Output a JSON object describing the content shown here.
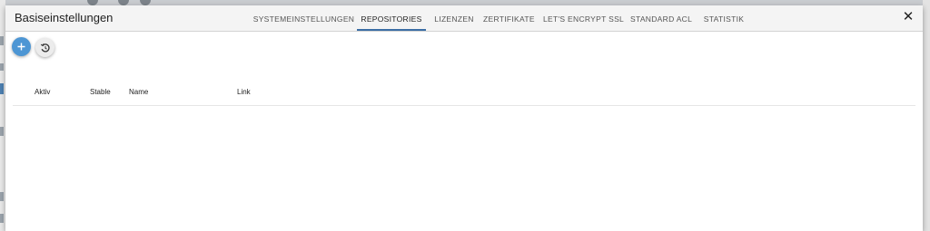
{
  "dialog": {
    "title": "Basiseinstellungen",
    "close_icon": "close-icon"
  },
  "tabs": [
    {
      "label": "SYSTEMEINSTELLUNGEN",
      "active": false
    },
    {
      "label": "REPOSITORIES",
      "active": true
    },
    {
      "label": "LIZENZEN",
      "active": false
    },
    {
      "label": "ZERTIFIKATE",
      "active": false
    },
    {
      "label": "LET'S ENCRYPT SSL",
      "active": false
    },
    {
      "label": "STANDARD ACL",
      "active": false
    },
    {
      "label": "STATISTIK",
      "active": false
    }
  ],
  "toolbar": {
    "add_icon": "plus-icon",
    "reset_icon": "restore-icon"
  },
  "table": {
    "columns": [
      "Aktiv",
      "Stable",
      "Name",
      "Link"
    ],
    "rows": []
  },
  "colors": {
    "accent": "#4d96d4",
    "tab_indicator": "#3b6ea5"
  }
}
